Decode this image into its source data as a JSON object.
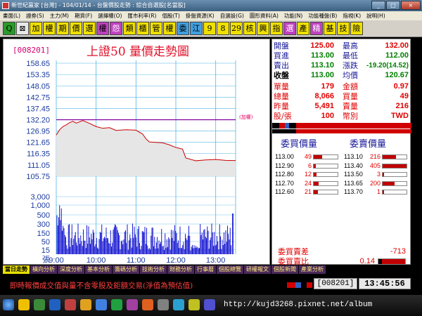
{
  "window": {
    "title": "新世紀贏家 [台灣] - 104/01/14 - 台盤價股走勢 : 綜合自選股[名當股]",
    "buttons": [
      "_",
      "□",
      "×"
    ]
  },
  "menu": [
    "畫面(L)",
    "證券(S)",
    "主力(M)",
    "期貨(F)",
    "選擇權(O)",
    "匯市利率(R)",
    "個股(T)",
    "掛盤資源(K)",
    "自選設(G)",
    "圖形資料(A)",
    "功能(N)",
    "功能種盤(B)",
    "指視(K)",
    "說明(H)"
  ],
  "toolbar": [
    {
      "char": "Q",
      "bg": "#2a9a2a",
      "fg": "#000"
    },
    {
      "char": "⊠",
      "bg": "#e8e8e8",
      "fg": "#000"
    },
    {
      "char": "加",
      "bg": "#f0e000",
      "fg": "#000"
    },
    {
      "char": "權",
      "bg": "#f0e000",
      "fg": "#000"
    },
    {
      "char": "期",
      "bg": "#f0e000",
      "fg": "#000"
    },
    {
      "char": "價",
      "bg": "#f0e000",
      "fg": "#000"
    },
    {
      "char": "選",
      "bg": "#f0e000",
      "fg": "#000"
    },
    {
      "char": "權",
      "bg": "#c040c0",
      "fg": "#000"
    },
    {
      "char": "怨",
      "bg": "#c040c0",
      "fg": "#fff"
    },
    {
      "char": "類",
      "bg": "#f0e000",
      "fg": "#000"
    },
    {
      "char": "櫃",
      "bg": "#f0e000",
      "fg": "#000"
    },
    {
      "char": "管",
      "bg": "#f0e000",
      "fg": "#000"
    },
    {
      "char": "權",
      "bg": "#f0e000",
      "fg": "#000"
    },
    {
      "char": "委",
      "bg": "#40a0e0",
      "fg": "#000"
    },
    {
      "char": "江",
      "bg": "#40a0e0",
      "fg": "#000"
    },
    {
      "char": "9",
      "bg": "#f0e000",
      "fg": "#000"
    },
    {
      "char": "8",
      "bg": "#f0e000",
      "fg": "#000"
    },
    {
      "char": "29",
      "bg": "#f0e000",
      "fg": "#000"
    },
    {
      "char": "核",
      "bg": "#f0e000",
      "fg": "#000"
    },
    {
      "char": "興",
      "bg": "#f0e000",
      "fg": "#000"
    },
    {
      "char": "指",
      "bg": "#f0e000",
      "fg": "#000"
    },
    {
      "char": "選",
      "bg": "#c040c0",
      "fg": "#fff"
    },
    {
      "char": "產",
      "bg": "#f0e000",
      "fg": "#000"
    },
    {
      "char": "精",
      "bg": "#c040c0",
      "fg": "#fff"
    },
    {
      "char": "基",
      "bg": "#f0e000",
      "fg": "#000"
    },
    {
      "char": "技",
      "bg": "#f0e000",
      "fg": "#000"
    },
    {
      "char": "險",
      "bg": "#f0e000",
      "fg": "#000"
    }
  ],
  "chart": {
    "code": "[008201]",
    "title": "上證50 量價走勢圖",
    "ref_label": "(加權)",
    "price_ticks": [
      "158.65",
      "153.35",
      "148.05",
      "142.75",
      "137.45",
      "132.20",
      "126.95",
      "121.65",
      "116.35",
      "111.05",
      "105.75"
    ],
    "volume_ticks": [
      "3,000",
      "1,000",
      "500",
      "300",
      "150",
      "50",
      "15",
      "張"
    ],
    "time_ticks": [
      "9:00",
      "10:00",
      "11:00",
      "12:00",
      "13:00"
    ]
  },
  "chart_data": {
    "type": "line",
    "xlabel": "",
    "ylabel": "",
    "x_range": [
      "9:00",
      "13:30"
    ],
    "ylim": [
      105.75,
      158.65
    ],
    "reference_price": 132.2,
    "series": [
      {
        "x": [
          "9:00",
          "9:05",
          "9:10",
          "9:15",
          "9:20",
          "9:25",
          "9:30",
          "9:40",
          "9:50",
          "10:00",
          "10:10",
          "10:20",
          "10:30",
          "10:45",
          "11:00",
          "11:10",
          "11:15",
          "11:20",
          "11:30",
          "11:40",
          "11:50",
          "12:00",
          "12:10",
          "12:15",
          "12:30",
          "12:45",
          "13:00",
          "13:15",
          "13:30"
        ],
        "values": [
          125.0,
          127.5,
          129.0,
          129.8,
          130.8,
          131.5,
          130.6,
          131.8,
          130.5,
          129.0,
          128.2,
          128.5,
          127.2,
          127.5,
          127.3,
          125.5,
          123.3,
          121.8,
          121.6,
          121.4,
          120.5,
          119.2,
          118.5,
          114.3,
          113.0,
          113.4,
          113.6,
          113.2,
          113.1
        ]
      }
    ]
  },
  "quote": {
    "open_label": "開盤",
    "open": "125.00",
    "high_label": "最高",
    "high": "132.00",
    "bid_label": "買進",
    "bid": "113.00",
    "low_label": "最低",
    "low": "112.00",
    "ask_label": "賣出",
    "ask": "113.10",
    "change_label": "漲跌",
    "change": "-19.20(14.52)",
    "close_label": "收盤",
    "close": "113.00",
    "avg_label": "均價",
    "avg": "120.67",
    "unit_vol_label": "單量",
    "unit_vol": "179",
    "amount_label": "金額",
    "amount": "0.97",
    "total_vol_label": "總量",
    "total_vol": "8,066",
    "buy_vol_label": "買量",
    "buy_vol": "49",
    "prev_vol_label": "昨量",
    "prev_vol": "5,491",
    "sell_vol_label": "賣量",
    "sell_vol": "216",
    "lot_label": "股/張",
    "lot": "100",
    "currency_label": "幣別",
    "currency": "TWD"
  },
  "orderbook": {
    "bid_header": "委買價量",
    "ask_header": "委賣價量",
    "bids": [
      {
        "price": "113.00",
        "vol": "49",
        "fill": 0.35
      },
      {
        "price": "112.90",
        "vol": "6",
        "fill": 0.08
      },
      {
        "price": "112.80",
        "vol": "12",
        "fill": 0.12
      },
      {
        "price": "112.70",
        "vol": "24",
        "fill": 0.2
      },
      {
        "price": "112.60",
        "vol": "21",
        "fill": 0.18
      }
    ],
    "asks": [
      {
        "price": "113.10",
        "vol": "216",
        "fill": 0.55
      },
      {
        "price": "113.40",
        "vol": "405",
        "fill": 1.0
      },
      {
        "price": "113.50",
        "vol": "3",
        "fill": 0.03
      },
      {
        "price": "113.65",
        "vol": "200",
        "fill": 0.5
      },
      {
        "price": "113.70",
        "vol": "1",
        "fill": 0.02
      }
    ]
  },
  "summary": {
    "diff_label": "委買賣差",
    "diff": "-713",
    "ratio_label": "委買賣比",
    "ratio": "0.14",
    "ratio_fill": 0.14
  },
  "tabs": [
    "當日走勢",
    "橫向分析",
    "深度分析",
    "基本分析",
    "籌碼分析",
    "技術分析",
    "財務分析",
    "行事曆",
    "個股總覽",
    "研權報文",
    "個股新聞",
    "產業分析"
  ],
  "status": {
    "message": "即時報價成交值與量不含零股及鉅額交易(淨值為預估值)",
    "code": "[008201]",
    "time": "13:45:56"
  },
  "taskbar": {
    "watermark": "http://kujd3268.pixnet.net/album"
  },
  "colors": {
    "price_line": "#cc0000",
    "reference_line": "#8000a0",
    "volume_bar": "#0000cc",
    "grid": "#4fb6e6",
    "fill": "#e6e6e6"
  }
}
